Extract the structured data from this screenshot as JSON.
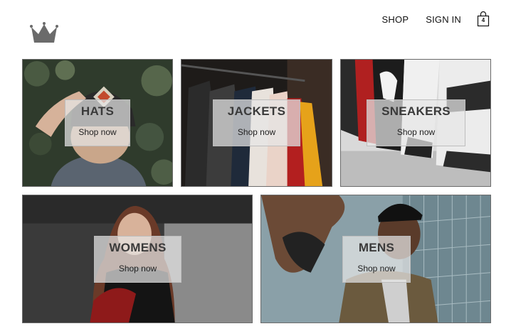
{
  "nav": {
    "shop_label": "SHOP",
    "signin_label": "SIGN IN",
    "cart_count": "4"
  },
  "categories": [
    {
      "title": "HATS",
      "cta": "Shop now"
    },
    {
      "title": "JACKETS",
      "cta": "Shop now"
    },
    {
      "title": "SNEAKERS",
      "cta": "Shop now"
    },
    {
      "title": "WOMENS",
      "cta": "Shop now"
    },
    {
      "title": "MENS",
      "cta": "Shop now"
    }
  ],
  "colors": {
    "crown": "#6b6b6b",
    "overlay_bg": "#e6e6e6",
    "border": "#6b6b6b"
  }
}
